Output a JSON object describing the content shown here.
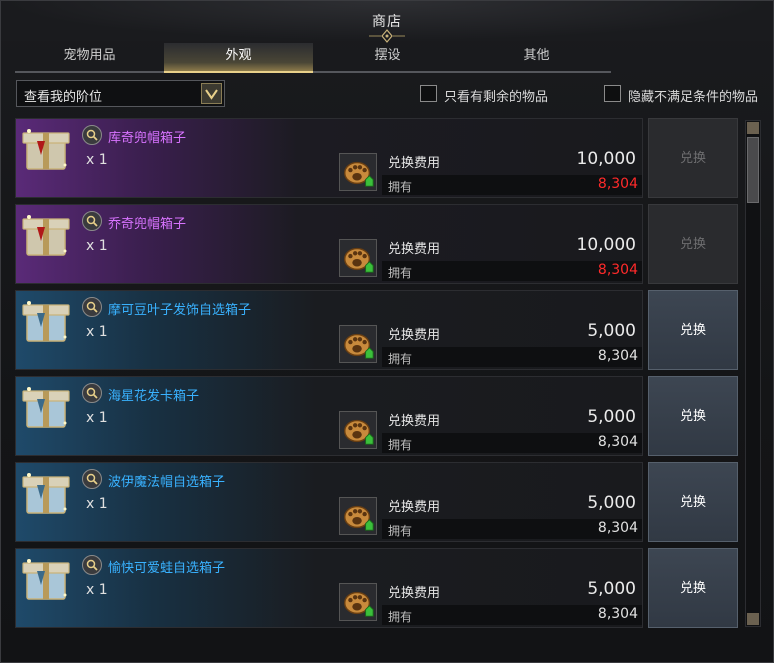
{
  "window": {
    "title": "商店"
  },
  "tabs": [
    {
      "label": "宠物用品",
      "active": false
    },
    {
      "label": "外观",
      "active": true
    },
    {
      "label": "摆设",
      "active": false
    },
    {
      "label": "其他",
      "active": false
    }
  ],
  "filter": {
    "dropdown_value": "查看我的阶位",
    "check_remaining": "只看有剩余的物品",
    "check_hide": "隐藏不满足条件的物品"
  },
  "items": [
    {
      "name": "库奇兜帽箱子",
      "grade": "purple",
      "qty": "x 1",
      "cost_label": "兑换费用",
      "cost": "10,000",
      "own_label": "拥有",
      "own": "8,304",
      "own_insufficient": true,
      "button": "兑换",
      "enabled": false
    },
    {
      "name": "乔奇兜帽箱子",
      "grade": "purple",
      "qty": "x 1",
      "cost_label": "兑换费用",
      "cost": "10,000",
      "own_label": "拥有",
      "own": "8,304",
      "own_insufficient": true,
      "button": "兑换",
      "enabled": false
    },
    {
      "name": "摩可豆叶子发饰自选箱子",
      "grade": "blue",
      "qty": "x 1",
      "cost_label": "兑换费用",
      "cost": "5,000",
      "own_label": "拥有",
      "own": "8,304",
      "own_insufficient": false,
      "button": "兑换",
      "enabled": true
    },
    {
      "name": "海星花发卡箱子",
      "grade": "blue",
      "qty": "x 1",
      "cost_label": "兑换费用",
      "cost": "5,000",
      "own_label": "拥有",
      "own": "8,304",
      "own_insufficient": false,
      "button": "兑换",
      "enabled": true
    },
    {
      "name": "波伊魔法帽自选箱子",
      "grade": "blue",
      "qty": "x 1",
      "cost_label": "兑换费用",
      "cost": "5,000",
      "own_label": "拥有",
      "own": "8,304",
      "own_insufficient": false,
      "button": "兑换",
      "enabled": true
    },
    {
      "name": "愉快可爱蛙自选箱子",
      "grade": "blue",
      "qty": "x 1",
      "cost_label": "兑换费用",
      "cost": "5,000",
      "own_label": "拥有",
      "own": "8,304",
      "own_insufficient": false,
      "button": "兑换",
      "enabled": true
    }
  ],
  "colors": {
    "accent_gold": "#e8d08a",
    "purple_name": "#d873ff",
    "blue_name": "#39b2ff",
    "insufficient": "#ff2a2a"
  },
  "icons": {
    "item": "gift-box-icon",
    "search": "magnifier-icon",
    "currency": "paw-token-icon",
    "dropdown": "chevron-down-icon"
  }
}
